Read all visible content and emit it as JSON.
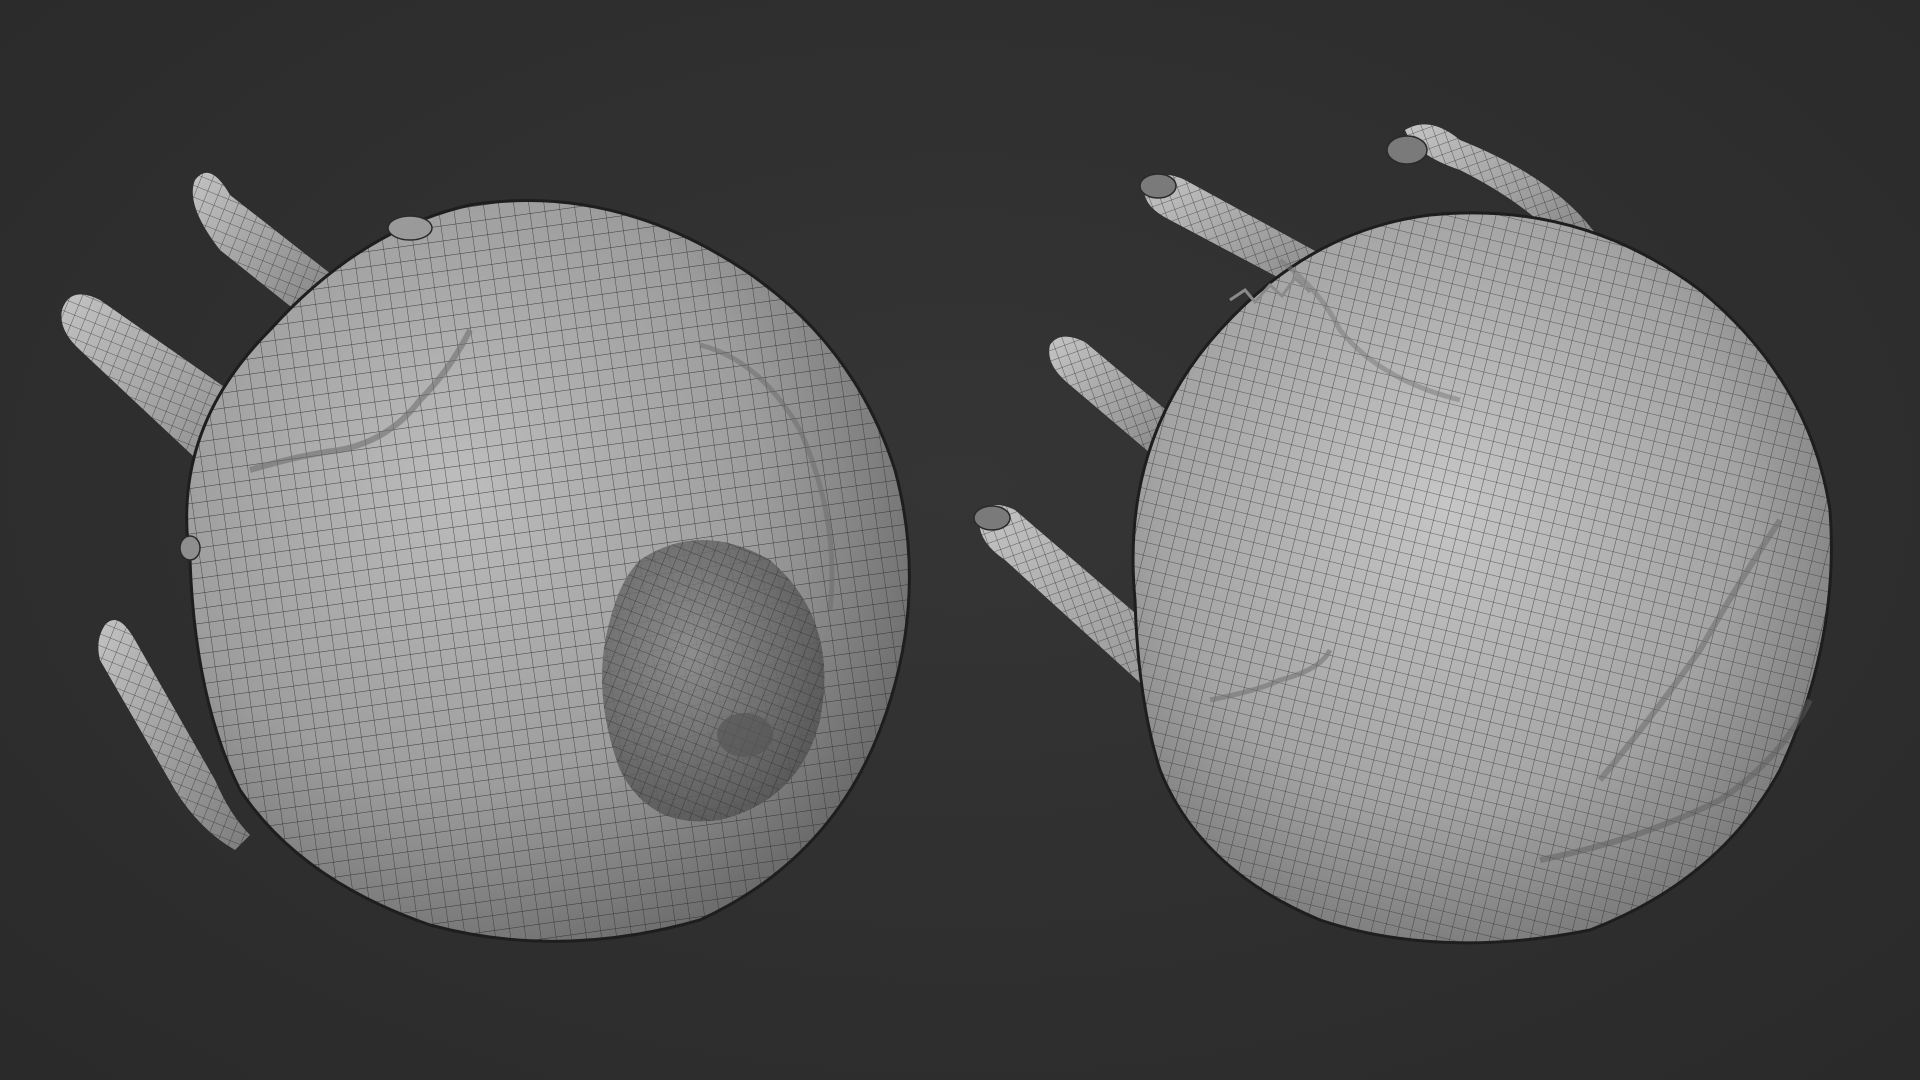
{
  "scene": {
    "background_color": "#2e2e2e",
    "mesh_base_color": "#a9a9a9",
    "wire_color": "#2a2a2a",
    "views": [
      {
        "id": "view-left",
        "subject": "sculpted-head-wireframe-top-view"
      },
      {
        "id": "view-right",
        "subject": "sculpted-head-wireframe-back-view"
      }
    ]
  }
}
